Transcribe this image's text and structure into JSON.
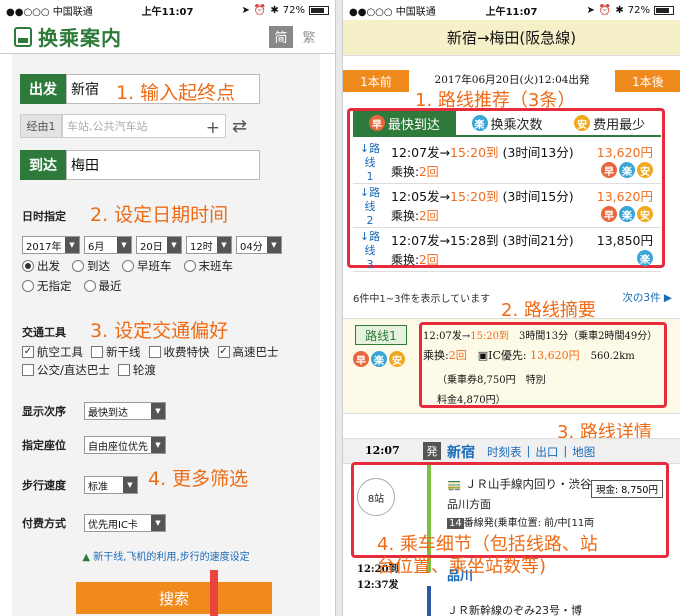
{
  "status": {
    "carrier": "●●○○○ 中国联通",
    "time": "上午11:07",
    "battery": "72%"
  },
  "left": {
    "logo": "换乘案内",
    "lang": [
      "简",
      "繁"
    ],
    "from_label": "出发",
    "from_value": "新宿",
    "via_label": "经由1",
    "via_placeholder": "车站,公共汽车站",
    "to_label": "到达",
    "to_value": "梅田",
    "annot1": "1. 输入起终点",
    "date_label": "日时指定",
    "annot2": "2. 设定日期时间",
    "date_selects": [
      "2017年",
      "6月",
      "20日",
      "12时",
      "04分"
    ],
    "time_opts_1": [
      "出发",
      "到达",
      "早班车",
      "末班车"
    ],
    "time_opts_2": [
      "无指定",
      "最近"
    ],
    "transport_label": "交通工具",
    "annot3": "3. 设定交通偏好",
    "transport_1": [
      {
        "label": "航空工具",
        "checked": true
      },
      {
        "label": "新干线",
        "checked": false
      },
      {
        "label": "收费特快",
        "checked": false
      },
      {
        "label": "高速巴士",
        "checked": true
      }
    ],
    "transport_2": [
      {
        "label": "公交/直达巴士",
        "checked": false
      },
      {
        "label": "轮渡",
        "checked": false
      }
    ],
    "order_label": "显示次序",
    "order_value": "最快到达",
    "seat_label": "指定座位",
    "seat_value": "自由座位优先",
    "walk_label": "步行速度",
    "walk_value": "标准",
    "pay_label": "付费方式",
    "pay_value": "优先用IC卡",
    "annot4": "4. 更多筛选",
    "info_link": "新干线,飞机的利用,步行的速度设定",
    "search": "搜索"
  },
  "right": {
    "title": "新宿→梅田(阪急線)",
    "prev": "1本前",
    "next": "1本後",
    "date": "2017年06月20日(火)12:04出発",
    "annot1": "1. 路线推荐（3条）",
    "tabs": [
      {
        "mark": "早",
        "label": "最快到达"
      },
      {
        "mark": "楽",
        "label": "换乘次数"
      },
      {
        "mark": "安",
        "label": "费用最少"
      }
    ],
    "routes": [
      {
        "tag": "路线",
        "num": "1",
        "dep": "12:07发→",
        "arr": "15:20到",
        "dur": "(3时间13分)",
        "fare": "13,620円",
        "transfers": "乘换:",
        "tcount": "2回",
        "marks": [
          "早",
          "楽",
          "安"
        ],
        "arr_red": true
      },
      {
        "tag": "路线",
        "num": "2",
        "dep": "12:05发→",
        "arr": "15:20到",
        "dur": "(3时间15分)",
        "fare": "13,620円",
        "transfers": "乘换:",
        "tcount": "2回",
        "marks": [
          "早",
          "楽",
          "安"
        ],
        "arr_red": true
      },
      {
        "tag": "路线",
        "num": "3",
        "dep": "12:07发→",
        "arr": "15:28到",
        "dur": "(3时间21分)",
        "fare": "13,850円",
        "transfers": "乘换:",
        "tcount": "2回",
        "marks": [
          "楽"
        ],
        "arr_red": false
      }
    ],
    "count_text": "6件中1~3件を表示しています",
    "next_link": "次の3件 ▶",
    "annot2": "2. 路线摘要",
    "summary": {
      "badge": "路线1",
      "line1_a": "12:07发→",
      "line1_b": "15:20到",
      "line1_c": "3時間13分（乗車2時間49分）",
      "line2_a": "乘换:",
      "line2_b": "2回",
      "line2_c": "IC優先:",
      "line2_d": "13,620円",
      "line2_e": "560.2km",
      "line3": "（乗車券8,750円　特別",
      "line4": "料金4,870円）"
    },
    "annot3": "3. 路线详情",
    "detail": {
      "time": "12:07",
      "badge": "発",
      "station": "新宿",
      "links": [
        "时刻表",
        "出口",
        "地图"
      ],
      "stops": "8站",
      "line_name": "ＪＲ山手線内回り・渋谷",
      "direction": "品川方面",
      "fare": "現金: 8,750円",
      "platform_num": "14",
      "platform": "番線発(乗車位置: 前/中[11両",
      "t2": "12:20到",
      "t3": "12:37发",
      "arr_station": "品川",
      "next_line": "ＪＲ新幹線のぞみ23号・博"
    },
    "annot4a": "4. 乘车细节（包括线路、站",
    "annot4b": "台位置、乘坐站数等)"
  }
}
